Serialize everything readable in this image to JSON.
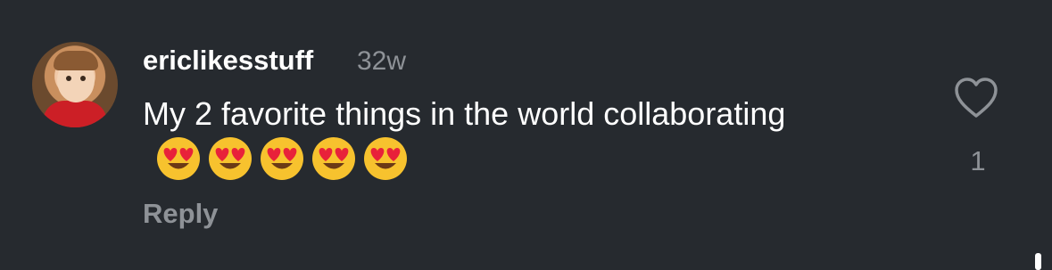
{
  "comment": {
    "username": "ericlikesstuff",
    "timestamp": "32w",
    "text": "My 2 favorite things in the world collaborating",
    "emojis": [
      "heart-eyes-emoji",
      "heart-eyes-emoji",
      "heart-eyes-emoji",
      "heart-eyes-emoji",
      "heart-eyes-emoji"
    ],
    "reply_label": "Reply",
    "like_count": "1",
    "like_icon": "heart-outline-icon"
  },
  "colors": {
    "background": "#262a2f",
    "primary_text": "#ffffff",
    "secondary_text": "#8e9297"
  }
}
